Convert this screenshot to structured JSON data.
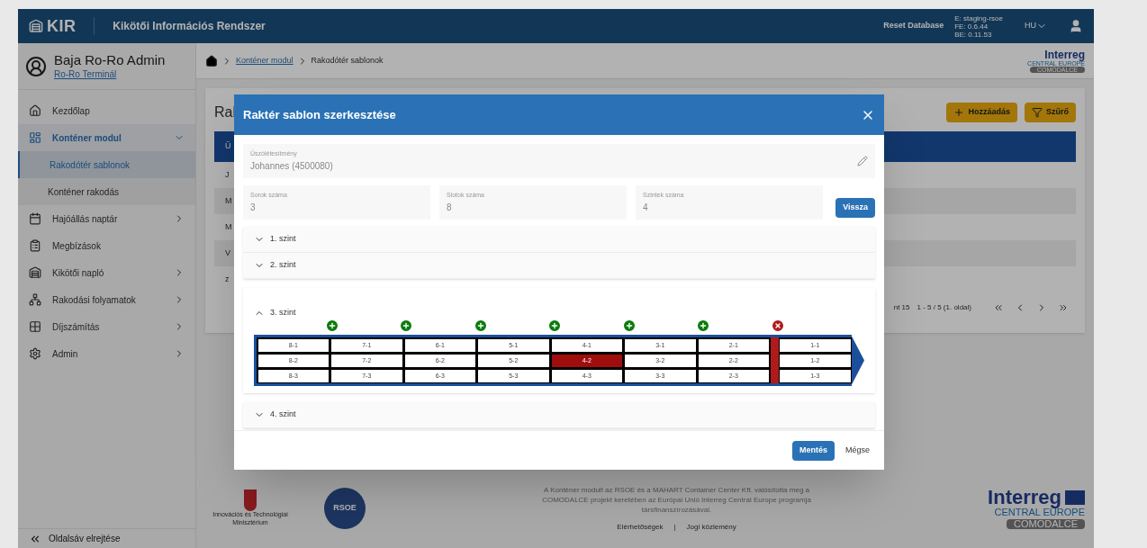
{
  "header": {
    "logo": "KIR",
    "title": "Kikötői Információs Rendszer",
    "reset": "Reset Database",
    "env": [
      "E: staging-rsoe",
      "FE: 0.6.44",
      "BE: 0.11.53"
    ],
    "language": "HU"
  },
  "user": {
    "name": "Baja Ro-Ro Admin",
    "org": "Ro-Ro Terminál"
  },
  "sidebar": {
    "items": [
      {
        "label": "Kezdőlap",
        "kind": "home",
        "selected": false
      },
      {
        "label": "Konténer modul",
        "kind": "module",
        "expanded": true,
        "selected": true,
        "children": [
          {
            "label": "Rakodótér sablonok",
            "selected": true
          },
          {
            "label": "Konténer rakodás",
            "selected": false
          }
        ]
      },
      {
        "label": "Hajóállás naptár",
        "kind": "calendar",
        "expanded": false,
        "selected": false
      },
      {
        "label": "Megbízások",
        "kind": "clipboard",
        "selected": false
      },
      {
        "label": "Kikötői napló",
        "kind": "log",
        "expanded": false,
        "selected": false
      },
      {
        "label": "Rakodási folyamatok",
        "kind": "process",
        "expanded": false,
        "selected": false
      },
      {
        "label": "Díjszámítás",
        "kind": "grid",
        "expanded": false,
        "selected": false
      },
      {
        "label": "Admin",
        "kind": "admin",
        "expanded": false,
        "selected": false
      }
    ],
    "hide": "Oldalsáv elrejtése"
  },
  "breadcrumb": [
    "Konténer modul",
    "Rakodótér sablonok"
  ],
  "partner_logo": {
    "name": "Interreg",
    "region": "CENTRAL EUROPE",
    "project": "COMODALCE"
  },
  "page": {
    "title": "Ral",
    "buttons": [
      "Hozzáadás",
      "Szűrő"
    ],
    "header_cell": "Ü",
    "rows": [
      "J",
      "M",
      "M",
      "V",
      "z"
    ],
    "page_size": "nt 15",
    "range": "1 - 5 / 5 (1. oldal)"
  },
  "dialog": {
    "title": "Raktér sablon szerkesztése",
    "vessel": {
      "label": "Úszólétesítmény",
      "value": "Johannes (4500080)"
    },
    "fields": [
      {
        "label": "Sorok száma",
        "value": "3"
      },
      {
        "label": "Slotok száma",
        "value": "8"
      },
      {
        "label": "Szintek száma",
        "value": "4"
      }
    ],
    "back": "Vissza",
    "levels": [
      {
        "label": "1. szint",
        "expanded": false
      },
      {
        "label": "2. szint",
        "expanded": false
      },
      {
        "label": "3. szint",
        "expanded": true,
        "dividers": [
          {
            "kind": "add"
          },
          {
            "kind": "add"
          },
          {
            "kind": "add"
          },
          {
            "kind": "add"
          },
          {
            "kind": "add"
          },
          {
            "kind": "add"
          },
          {
            "kind": "wall"
          }
        ],
        "rows": [
          [
            {
              "label": "8-1",
              "selected": false
            },
            {
              "label": "7-1",
              "selected": false
            },
            {
              "label": "6-1",
              "selected": false
            },
            {
              "label": "5-1",
              "selected": false
            },
            {
              "label": "4-1",
              "selected": false
            },
            {
              "label": "3-1",
              "selected": false
            },
            {
              "label": "2-1",
              "selected": false
            },
            {
              "label": "1-1",
              "selected": false
            }
          ],
          [
            {
              "label": "8-2",
              "selected": false
            },
            {
              "label": "7-2",
              "selected": false
            },
            {
              "label": "6-2",
              "selected": false
            },
            {
              "label": "5-2",
              "selected": false
            },
            {
              "label": "4-2",
              "selected": true
            },
            {
              "label": "3-2",
              "selected": false
            },
            {
              "label": "2-2",
              "selected": false
            },
            {
              "label": "1-2",
              "selected": false
            }
          ],
          [
            {
              "label": "8-3",
              "selected": false
            },
            {
              "label": "7-3",
              "selected": false
            },
            {
              "label": "6-3",
              "selected": false
            },
            {
              "label": "5-3",
              "selected": false
            },
            {
              "label": "4-3",
              "selected": false
            },
            {
              "label": "3-3",
              "selected": false
            },
            {
              "label": "2-3",
              "selected": false
            },
            {
              "label": "1-3",
              "selected": false
            }
          ]
        ]
      },
      {
        "label": "4. szint",
        "expanded": false
      }
    ],
    "save": "Mentés",
    "cancel": "Mégse"
  },
  "footer": {
    "ministry": "Innovációs és Technológiai Minisztérium",
    "rsoe": "RSOE",
    "text": "A Konténer modult az RSOE és a MAHART Container Center Kft. valósította meg a COMODALCE projekt keretében az Európai Unió Interreg Central Europe programja társfinanszírozásával.",
    "links": [
      "Elérhetőségek",
      "Jogi közlemény"
    ],
    "separator": "|",
    "logo": {
      "name": "Interreg",
      "region": "CENTRAL EUROPE",
      "project": "COMODALCE"
    }
  }
}
